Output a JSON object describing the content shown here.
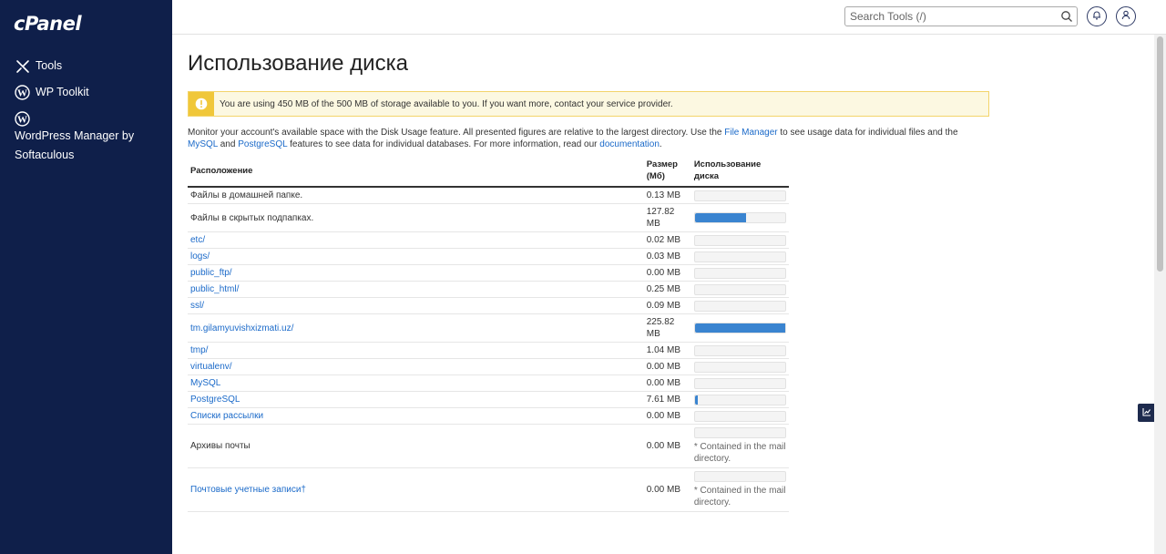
{
  "sidebar": {
    "logo": "cPanel",
    "items": [
      {
        "label": "Tools",
        "icon": "tools-icon"
      },
      {
        "label": "WP Toolkit",
        "icon": "wordpress-icon"
      },
      {
        "label": "WordPress Manager by",
        "label2": "Softaculous",
        "icon": "wordpress-icon"
      }
    ]
  },
  "header": {
    "search_placeholder": "Search Tools (/)"
  },
  "page": {
    "title": "Использование диска",
    "alert": "You are using 450 MB of the 500 MB of storage available to you. If you want more, contact your service provider.",
    "intro": {
      "p1": "Monitor your account's available space with the Disk Usage feature. All presented figures are relative to the largest directory. Use the ",
      "link_file_manager": "File Manager",
      "p2": " to see usage data for individual files and the ",
      "link_mysql": "MySQL",
      "p3": " and ",
      "link_postgresql": "PostgreSQL",
      "p4": " features to see data for individual databases. For more information, read our ",
      "link_documentation": "documentation",
      "p5": "."
    }
  },
  "table": {
    "headers": {
      "location": "Расположение",
      "size": "Размер (Мб)",
      "usage": "Использование диска"
    },
    "rows": [
      {
        "location": "Файлы в домашней папке.",
        "size": "0.13 MB",
        "usage_pct": 0,
        "link": false
      },
      {
        "location": "Файлы в скрытых подпапках.",
        "size": "127.82 MB",
        "usage_pct": 56.6,
        "link": false
      },
      {
        "location": "etc/",
        "size": "0.02 MB",
        "usage_pct": 0,
        "link": true
      },
      {
        "location": "logs/",
        "size": "0.03 MB",
        "usage_pct": 0,
        "link": true
      },
      {
        "location": "public_ftp/",
        "size": "0.00 MB",
        "usage_pct": 0,
        "link": true
      },
      {
        "location": "public_html/",
        "size": "0.25 MB",
        "usage_pct": 0,
        "link": true
      },
      {
        "location": "ssl/",
        "size": "0.09 MB",
        "usage_pct": 0,
        "link": true
      },
      {
        "location": "tm.gilamyuvishxizmati.uz/",
        "size": "225.82 MB",
        "usage_pct": 100,
        "link": true
      },
      {
        "location": "tmp/",
        "size": "1.04 MB",
        "usage_pct": 0,
        "link": true
      },
      {
        "location": "virtualenv/",
        "size": "0.00 MB",
        "usage_pct": 0,
        "link": true
      },
      {
        "location": "MySQL",
        "size": "0.00 MB",
        "usage_pct": 0,
        "link": true
      },
      {
        "location": "PostgreSQL",
        "size": "7.61 MB",
        "usage_pct": 3.4,
        "link": true
      },
      {
        "location": "Списки рассылки",
        "size": "0.00 MB",
        "usage_pct": 0,
        "link": true
      },
      {
        "location": "Архивы почты",
        "size": "0.00 MB",
        "usage_pct": 0,
        "link": false,
        "note": "* Contained in the mail directory."
      },
      {
        "location": "Почтовые учетные записи†",
        "size": "0.00 MB",
        "usage_pct": 0,
        "link": true,
        "note": "* Contained in the mail directory."
      }
    ]
  },
  "colors": {
    "sidebar_bg": "#0f1f4a",
    "link": "#1b6ac9",
    "bar_fill": "#3a84d0",
    "alert_bg": "#fcf8e1",
    "alert_icon": "#f0c73a"
  }
}
